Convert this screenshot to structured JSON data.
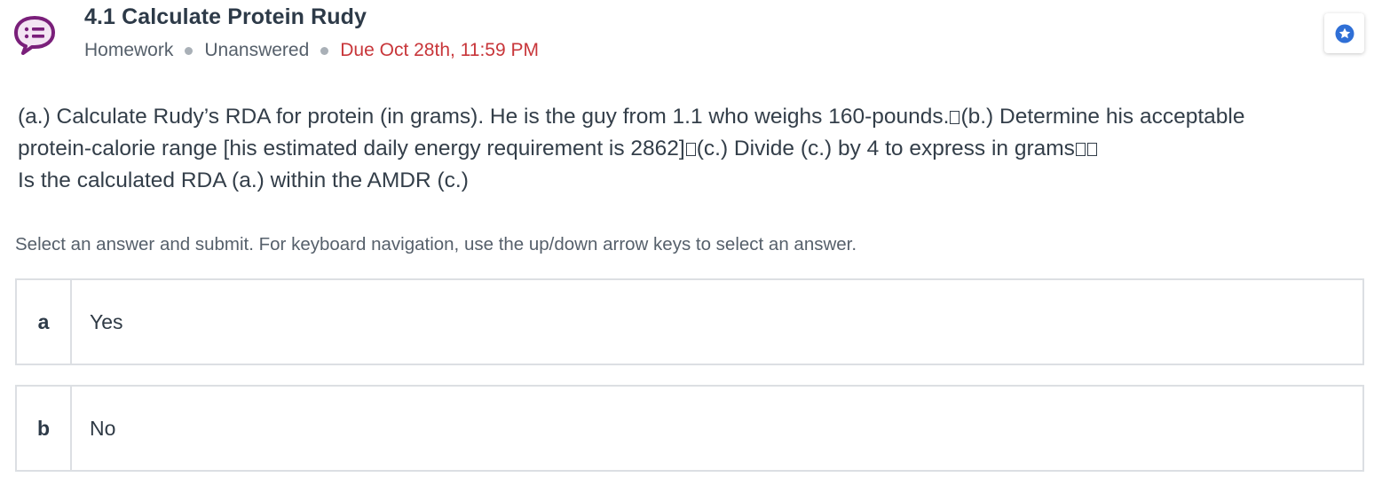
{
  "header": {
    "title": "4.1 Calculate Protein Rudy",
    "type": "Homework",
    "status": "Unanswered",
    "due": "Due Oct 28th, 11:59 PM",
    "icon": "question-list-icon",
    "star_icon": "star-icon"
  },
  "question": {
    "line1": "(a.) Calculate Rudy’s RDA for protein (in grams). He is the guy from 1.1 who weighs 160-pounds.",
    "line1b": "(b.) Determine his acceptable",
    "line2": "protein-calorie range [his estimated daily energy requirement is 2862]",
    "line2b": "(c.) Divide (c.) by 4 to express in grams",
    "line3": "Is the calculated RDA (a.) within the AMDR (c.)"
  },
  "instructions": "Select an answer and submit. For keyboard navigation, use the up/down arrow keys to select an answer.",
  "answers": [
    {
      "letter": "a",
      "text": "Yes"
    },
    {
      "letter": "b",
      "text": "No"
    }
  ],
  "colors": {
    "icon_purple": "#7a1f7a",
    "due_red": "#c8363a",
    "star_blue": "#2f6fd6"
  }
}
